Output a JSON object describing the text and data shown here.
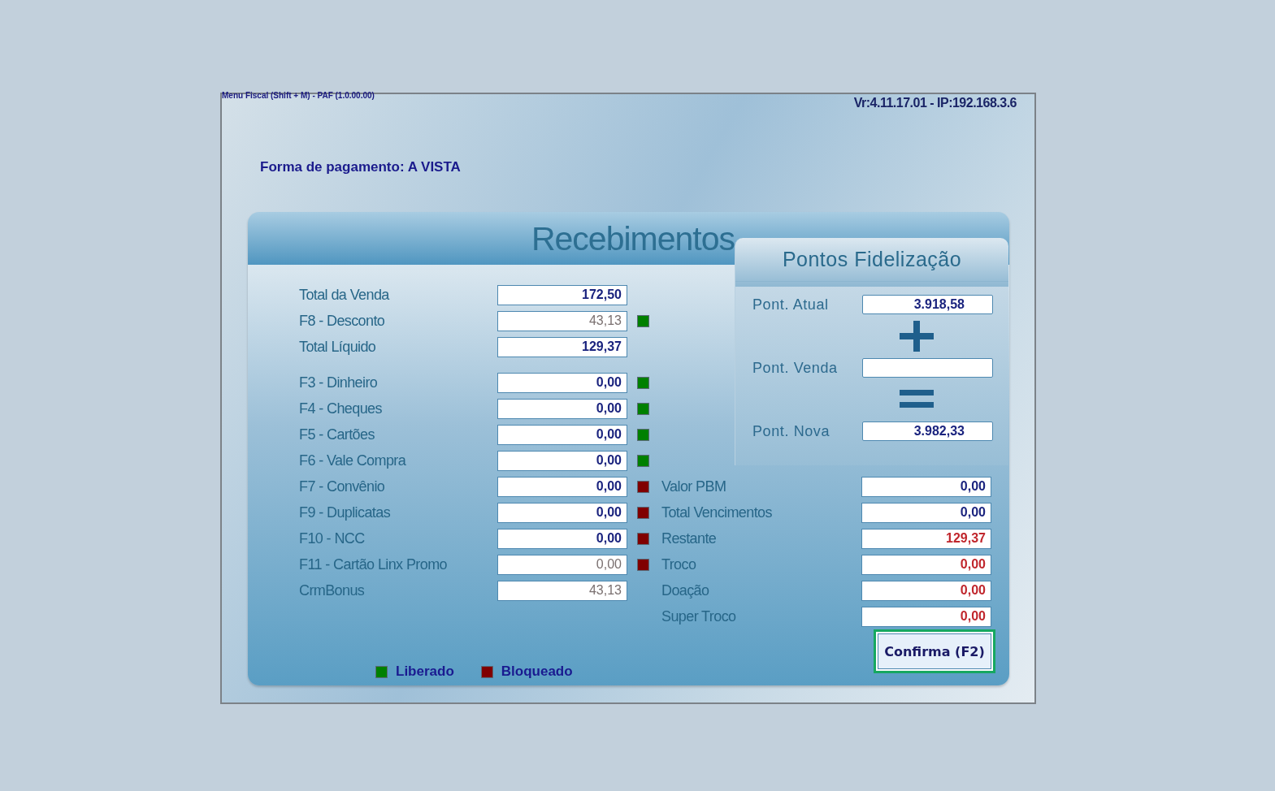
{
  "window": {
    "menu_hint": "Menu Fiscal (Shift + M) - PAF (1.0.00.00)",
    "version": "Vr:4.11.17.01 - IP:192.168.3.6"
  },
  "payment_method": "Forma de pagamento: A VISTA",
  "panel": {
    "title": "Recebimentos"
  },
  "summary": [
    {
      "label": "Total da Venda",
      "value": "172,50",
      "disabled": false
    },
    {
      "label": "F8 - Desconto",
      "value": "43,13",
      "disabled": true,
      "color": "#008000"
    },
    {
      "label": "Total Líquido",
      "value": "129,37",
      "disabled": false
    }
  ],
  "payments": [
    {
      "label": "F3 - Dinheiro",
      "value": "0,00",
      "disabled": false,
      "color": "#008000"
    },
    {
      "label": "F4 - Cheques",
      "value": "0,00",
      "disabled": false,
      "color": "#008000"
    },
    {
      "label": "F5 - Cartões",
      "value": "0,00",
      "disabled": false,
      "color": "#008000"
    },
    {
      "label": "F6 - Vale Compra",
      "value": "0,00",
      "disabled": false,
      "color": "#008000"
    },
    {
      "label": "F7 - Convênio",
      "value": "0,00",
      "disabled": false,
      "color": "#800000"
    },
    {
      "label": "F9 - Duplicatas",
      "value": "0,00",
      "disabled": false,
      "color": "#800000"
    },
    {
      "label": "F10 - NCC",
      "value": "0,00",
      "disabled": false,
      "color": "#800000"
    },
    {
      "label": "F11 - Cartão Linx Promo",
      "value": "0,00",
      "disabled": true,
      "color": "#800000"
    },
    {
      "label": "CrmBonus",
      "value": "43,13",
      "disabled": true
    }
  ],
  "loyalty": {
    "title": "Pontos Fidelização",
    "items": [
      {
        "kind": "field",
        "label": "Pont. Atual",
        "value": "3.918,58"
      },
      {
        "kind": "plus"
      },
      {
        "kind": "field",
        "label": "Pont. Venda"
      },
      {
        "kind": "equals"
      },
      {
        "kind": "field",
        "label": "Pont. Nova",
        "value": "3.982,33"
      }
    ]
  },
  "totals": [
    {
      "label": "Valor PBM",
      "value": "0,00",
      "alert": false
    },
    {
      "label": "Total Vencimentos",
      "value": "0,00",
      "alert": false
    },
    {
      "label": "Restante",
      "value": "129,37",
      "alert": true
    },
    {
      "label": "Troco",
      "value": "0,00",
      "alert": true
    },
    {
      "label": "Doação",
      "value": "0,00",
      "alert": true
    },
    {
      "label": "Super Troco",
      "value": "0,00",
      "alert": true
    }
  ],
  "legend": [
    {
      "label": "Liberado",
      "color": "#008000"
    },
    {
      "label": "Bloqueado",
      "color": "#800000"
    }
  ],
  "confirm": {
    "label": "Confirma (F2)",
    "focused": true
  }
}
